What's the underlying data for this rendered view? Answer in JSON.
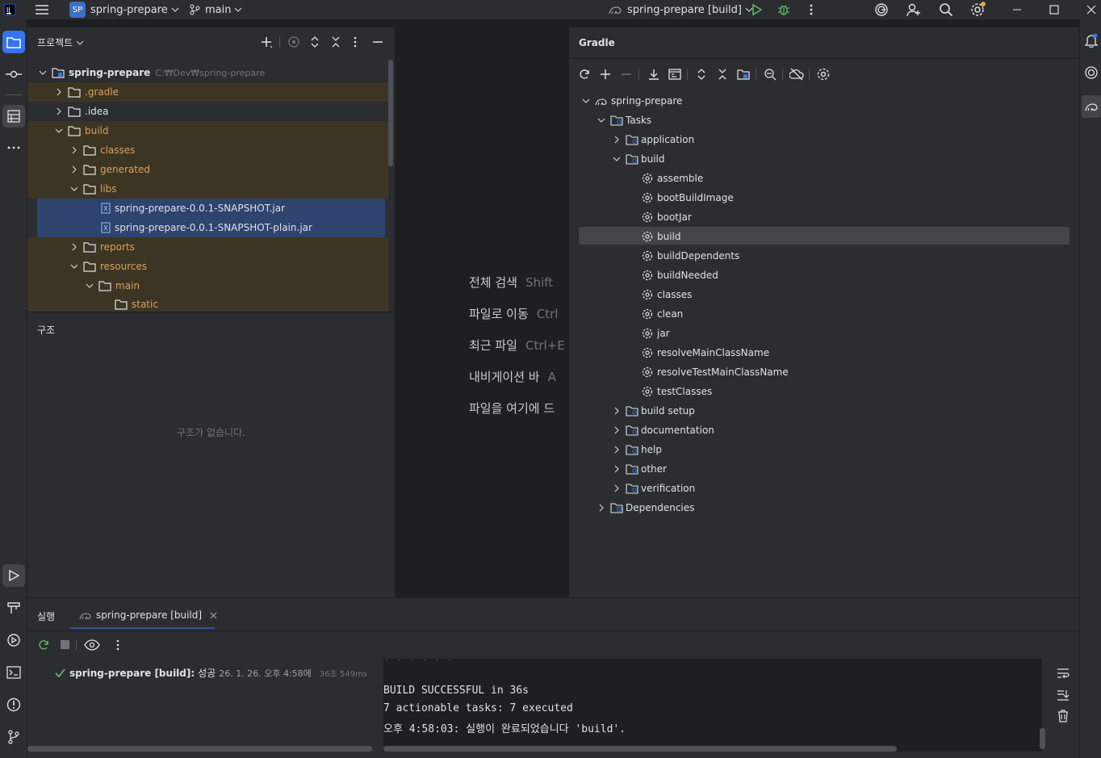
{
  "titlebar": {
    "project_badge": "SP",
    "project_name": "spring-prepare",
    "branch": "main",
    "run_config": "spring-prepare [build]"
  },
  "project_panel": {
    "title": "프로젝트",
    "root_name": "spring-prepare",
    "root_path": "C:₩Dev₩spring-prepare",
    "items": [
      {
        "label": ".gradle"
      },
      {
        "label": ".idea"
      },
      {
        "label": "build"
      },
      {
        "label": "classes"
      },
      {
        "label": "generated"
      },
      {
        "label": "libs"
      },
      {
        "label": "spring-prepare-0.0.1-SNAPSHOT.jar"
      },
      {
        "label": "spring-prepare-0.0.1-SNAPSHOT-plain.jar"
      },
      {
        "label": "reports"
      },
      {
        "label": "resources"
      },
      {
        "label": "main"
      },
      {
        "label": "static"
      }
    ]
  },
  "structure_panel": {
    "title": "구조",
    "empty_text": "구조가 없습니다."
  },
  "editor_hints": [
    {
      "label": "전체 검색",
      "key": "Shift"
    },
    {
      "label": "파일로 이동",
      "key": "Ctrl"
    },
    {
      "label": "최근 파일",
      "key": "Ctrl+E"
    },
    {
      "label": "내비게이션 바",
      "key": "A"
    },
    {
      "label": "파일을 여기에 드",
      "key": ""
    }
  ],
  "gradle_panel": {
    "title": "Gradle",
    "root": "spring-prepare",
    "tasks_label": "Tasks",
    "groups_before": [
      "application"
    ],
    "build_group": "build",
    "build_tasks": [
      "assemble",
      "bootBuildImage",
      "bootJar",
      "build",
      "buildDependents",
      "buildNeeded",
      "classes",
      "clean",
      "jar",
      "resolveMainClassName",
      "resolveTestMainClassName",
      "testClasses"
    ],
    "selected_task": "build",
    "groups_after": [
      "build setup",
      "documentation",
      "help",
      "other",
      "verification"
    ],
    "dependencies_label": "Dependencies"
  },
  "run_panel": {
    "title": "실행",
    "tab_label": "spring-prepare [build]",
    "result_name": "spring-prepare [build]:",
    "result_status": "성공",
    "result_time": "26. 1. 26. 오후 4:58에",
    "duration": "36초 549ms",
    "console_lines": [
      "BUILD SUCCESSFUL in 36s",
      "7 actionable tasks: 7 executed",
      "오후 4:58:03: 실행이 완료되었습니다 'build'."
    ]
  },
  "colors": {
    "accent": "#3574f0",
    "success": "#5fb865",
    "excluded_folder": "#d9a15c",
    "selection": "#2e436e"
  }
}
